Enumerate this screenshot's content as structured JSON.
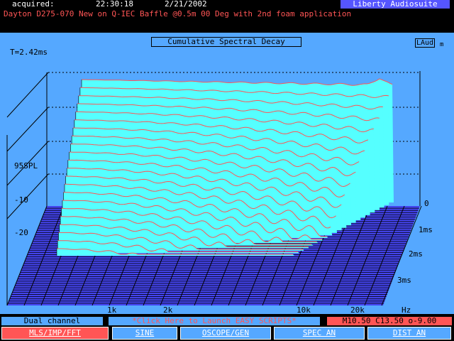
{
  "header": {
    "acquired_label": "acquired:",
    "time": "22:30:18",
    "date": "2/21/2002",
    "brand": "Liberty Audiosuite",
    "subtitle": "Dayton D275-070 New on Q-IEC Baffle @0.5m 00 Deg with 2nd foam application"
  },
  "plot": {
    "title": "Cumulative Spectral Decay",
    "laud_label": "LAud",
    "laud_sub": "m",
    "time_readout": "T=2.42ms",
    "spl_label": "95SPL",
    "spl_ticks": [
      "-10",
      "-20"
    ],
    "time_axis": [
      "0",
      "1ms",
      "2ms",
      "3ms"
    ],
    "freq_axis": [
      "1k",
      "2k",
      "10k",
      "20k"
    ],
    "freq_unit": "Hz",
    "colors": {
      "plot_bg": "#55a8ff",
      "waterfall_fill": "#55ffff",
      "trace_line": "#ff5555",
      "floor_fill": "#4444ee"
    }
  },
  "status": {
    "channel": "Dual channel",
    "scripts_link": "*Click Here to Launch EASY SCRIPTS*",
    "readout": "M10.50 C13.50 o-9.00"
  },
  "buttons": [
    {
      "label": "MLS/IMP/FFT",
      "active": true
    },
    {
      "label": "SINE",
      "active": false
    },
    {
      "label": "OSCOPE/GEN",
      "active": false
    },
    {
      "label": "SPEC AN",
      "active": false
    },
    {
      "label": "DIST AN",
      "active": false
    }
  ]
}
